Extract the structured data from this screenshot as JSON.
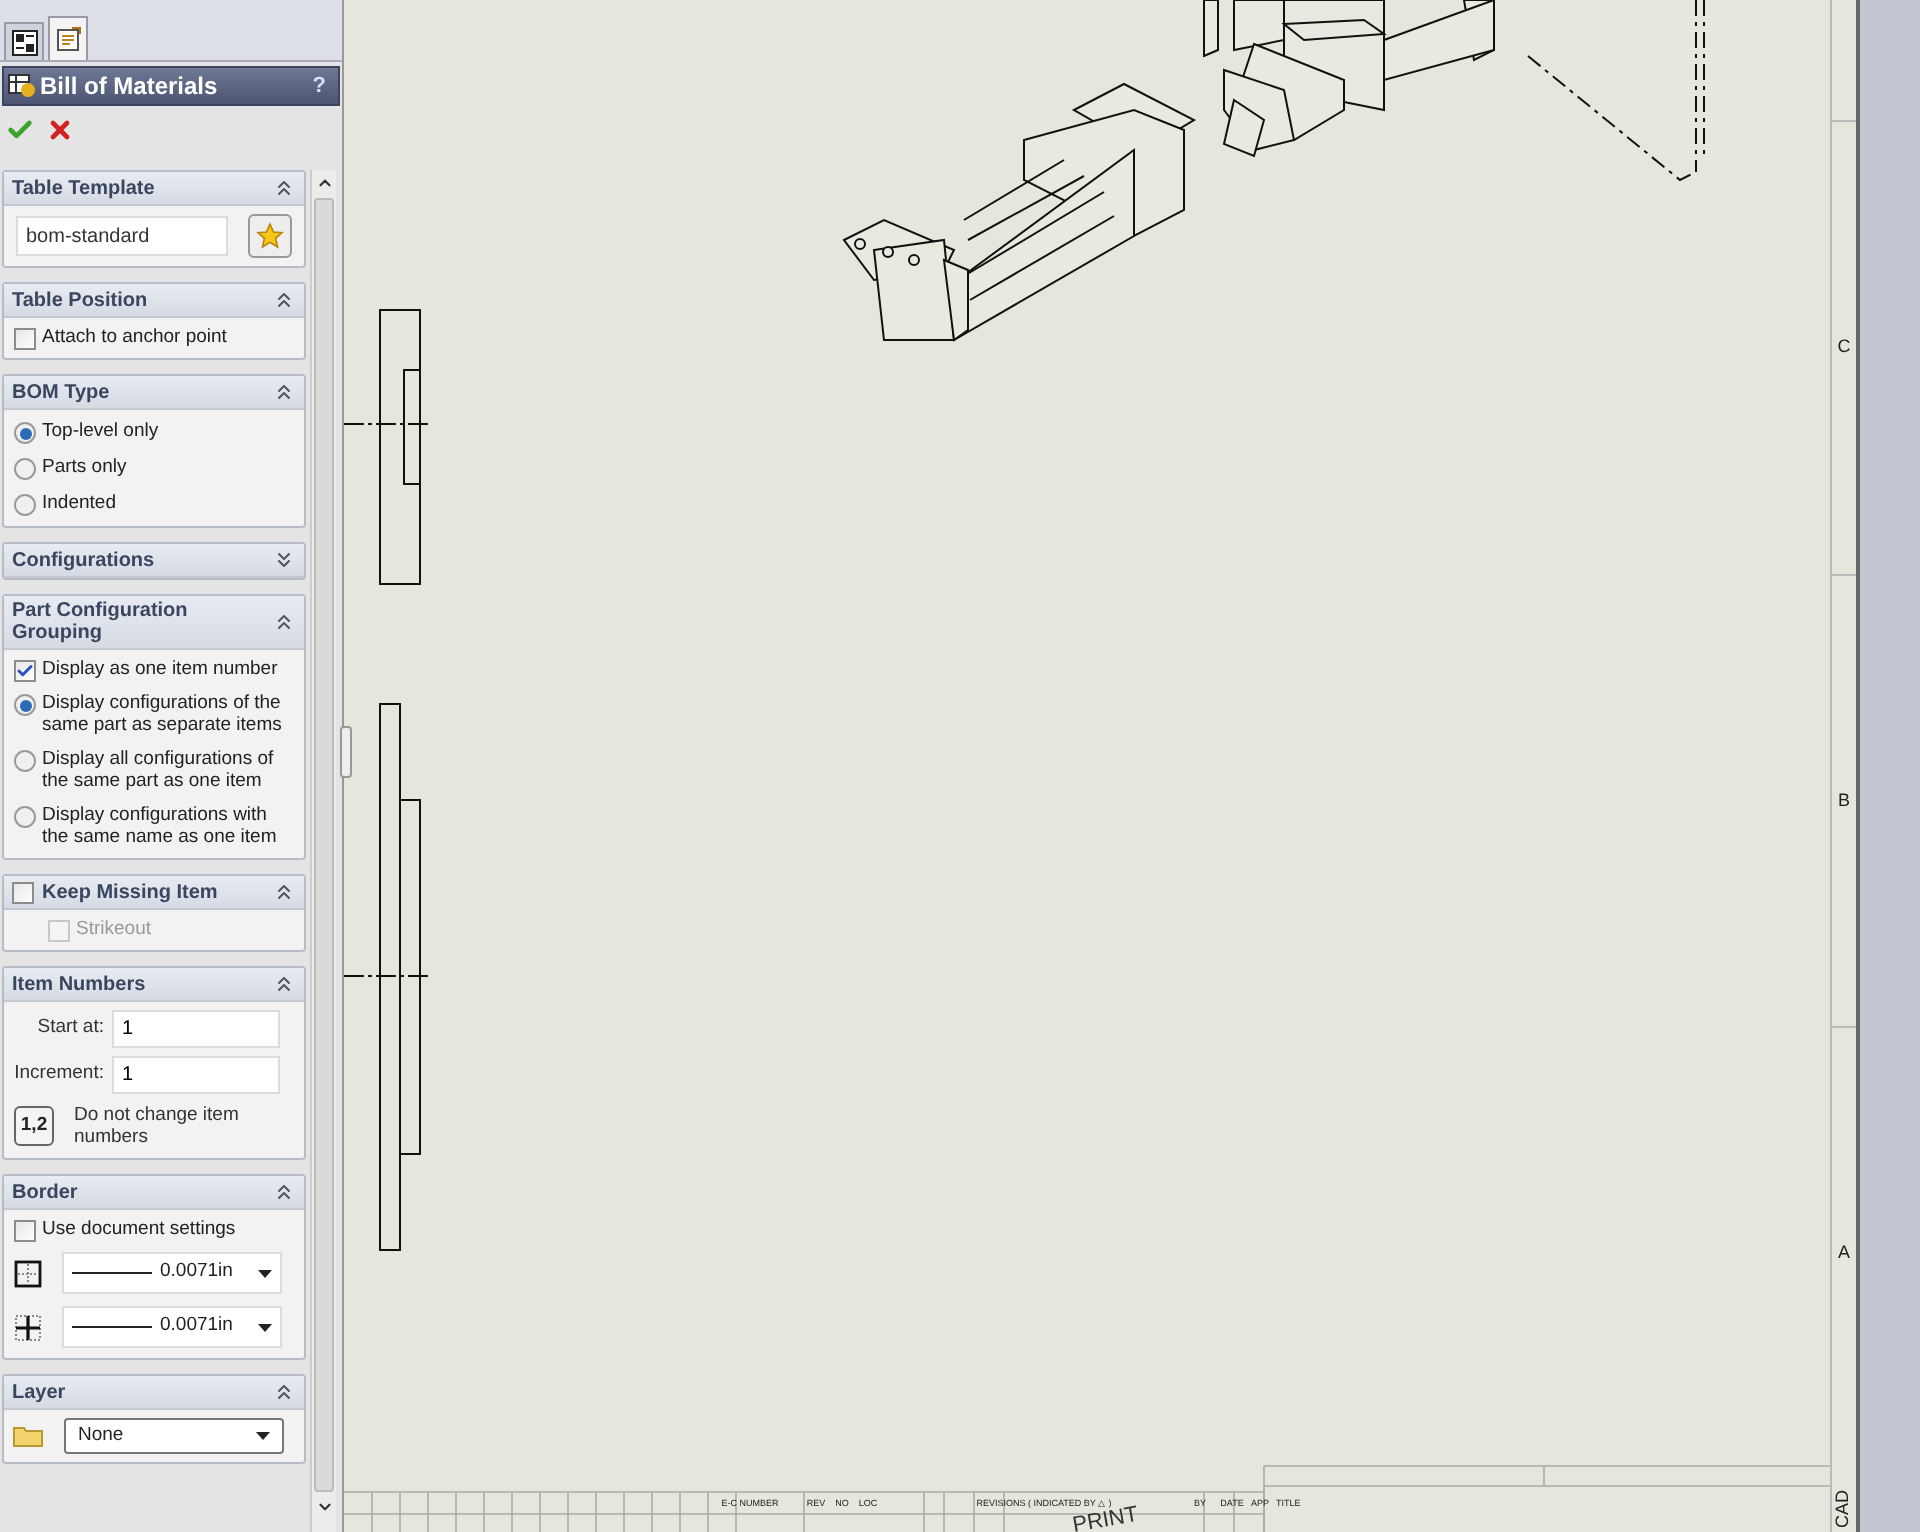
{
  "panel_tabs": [
    {
      "selected": false
    },
    {
      "selected": true
    }
  ],
  "header": {
    "title": "Bill of Materials",
    "help": "?"
  },
  "sections": [
    {
      "title": "Table Template",
      "expanded": true,
      "items": [
        {
          "kind": "template",
          "value": "bom-standard"
        }
      ]
    },
    {
      "title": "Table Position",
      "expanded": true,
      "items": [
        {
          "kind": "checkbox",
          "label": "Attach to anchor point",
          "checked": false,
          "disabled": false
        }
      ]
    },
    {
      "title": "BOM Type",
      "expanded": true,
      "items": [
        {
          "kind": "radio",
          "label": "Top-level only",
          "selected": true
        },
        {
          "kind": "radio",
          "label": "Parts only",
          "selected": false
        },
        {
          "kind": "radio",
          "label": "Indented",
          "selected": false
        }
      ]
    },
    {
      "title": "Configurations",
      "expanded": false
    },
    {
      "title": "Part Configuration Grouping",
      "expanded": true,
      "items": [
        {
          "kind": "checkbox",
          "label": "Display as one item number",
          "checked": true,
          "disabled": false
        },
        {
          "kind": "radio",
          "label": "Display configurations of the same part as separate items",
          "selected": true
        },
        {
          "kind": "radio",
          "label": "Display all configurations of the same part as one item",
          "selected": false
        },
        {
          "kind": "radio",
          "label": "Display configurations with the same name as one item",
          "selected": false
        }
      ]
    },
    {
      "title": "Keep Missing Item",
      "expanded": true,
      "checked": false,
      "items": [
        {
          "kind": "checkbox",
          "label": "Strikeout",
          "checked": false,
          "disabled": true
        }
      ]
    },
    {
      "title": "Item Numbers",
      "expanded": true,
      "items": [
        {
          "kind": "field",
          "label": "Start at:",
          "value": "1"
        },
        {
          "kind": "field",
          "label": "Increment:",
          "value": "1"
        },
        {
          "kind": "note",
          "button": "1,2",
          "label": "Do not change item numbers"
        }
      ]
    },
    {
      "title": "Border",
      "expanded": true,
      "items": [
        {
          "kind": "checkbox",
          "label": "Use document settings",
          "checked": false,
          "disabled": false
        },
        {
          "kind": "line",
          "value": "0.0071in"
        },
        {
          "kind": "line",
          "value": "0.0071in"
        }
      ]
    },
    {
      "title": "Layer",
      "expanded": true,
      "items": [
        {
          "kind": "select",
          "value": "None"
        }
      ]
    }
  ],
  "drawing": {
    "zones": [
      "C",
      "B",
      "A"
    ],
    "side_label": "CAD",
    "title_block": {
      "columns": [
        "E-C NUMBER",
        "REV",
        "NO",
        "LOC",
        "REVISIONS ( INDICATED BY △ )",
        "BY",
        "DATE",
        "APP"
      ],
      "title_label": "TITLE",
      "stamp": "PRINT"
    }
  }
}
